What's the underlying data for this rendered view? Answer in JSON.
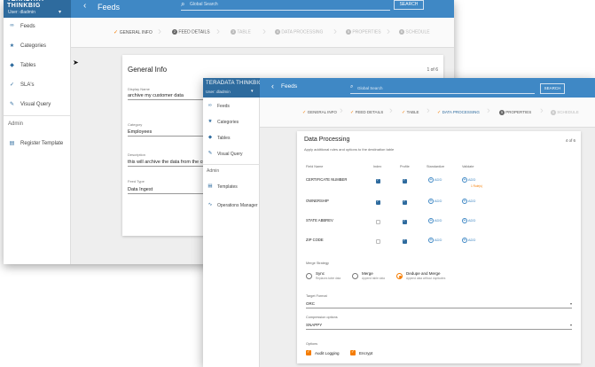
{
  "back": {
    "brand": {
      "logo": "TERADATA THINKBIG",
      "user": "User: dladmin"
    },
    "header": {
      "title": "Feeds",
      "search_placeholder": "Global Search",
      "search_button": "SEARCH"
    },
    "sidebar": {
      "items": [
        {
          "label": "Feeds",
          "icon": "link-icon"
        },
        {
          "label": "Categories",
          "icon": "star-icon"
        },
        {
          "label": "Tables",
          "icon": "database-icon"
        },
        {
          "label": "SLA's",
          "icon": "sla-icon"
        },
        {
          "label": "Visual Query",
          "icon": "pencil-icon"
        }
      ],
      "section_admin": "Admin",
      "admin_items": [
        {
          "label": "Register Template",
          "icon": "template-icon"
        }
      ]
    },
    "steps": [
      {
        "label": "GENERAL INFO",
        "state": "done"
      },
      {
        "num": "2",
        "label": "FEED DETAILS",
        "state": "current"
      },
      {
        "num": "3",
        "label": "TABLE",
        "state": "todo"
      },
      {
        "num": "4",
        "label": "DATA PROCESSING",
        "state": "todo"
      },
      {
        "num": "5",
        "label": "PROPERTIES",
        "state": "todo"
      },
      {
        "num": "6",
        "label": "SCHEDULE",
        "state": "todo"
      }
    ],
    "card": {
      "title": "General Info",
      "page": "1 of 6",
      "fields": [
        {
          "label": "Display Name",
          "value": "archive my customer data"
        },
        {
          "label": "Category",
          "value": "Employees"
        },
        {
          "label": "Description",
          "value": "this will archive the data from the customer"
        },
        {
          "label": "Feed Type",
          "value": "Data Ingest"
        }
      ]
    }
  },
  "front": {
    "brand": {
      "logo": "TERADATA THINKBIG",
      "user": "User: dladmin"
    },
    "header": {
      "title": "Feeds",
      "search_placeholder": "Global Search",
      "search_button": "SEARCH"
    },
    "sidebar": {
      "items": [
        {
          "label": "Feeds",
          "icon": "link-icon"
        },
        {
          "label": "Categories",
          "icon": "star-icon"
        },
        {
          "label": "Tables",
          "icon": "database-icon"
        },
        {
          "label": "Visual Query",
          "icon": "pencil-icon"
        }
      ],
      "section_admin": "Admin",
      "admin_items": [
        {
          "label": "Templates",
          "icon": "template-icon"
        },
        {
          "label": "Operations Manager",
          "icon": "pulse-icon"
        }
      ]
    },
    "steps": [
      {
        "label": "GENERAL INFO",
        "state": "done"
      },
      {
        "label": "FEED DETAILS",
        "state": "done"
      },
      {
        "label": "TABLE",
        "state": "done"
      },
      {
        "label": "DATA PROCESSING",
        "state": "current"
      },
      {
        "num": "5",
        "label": "PROPERTIES",
        "state": "next"
      },
      {
        "num": "6",
        "label": "SCHEDULE",
        "state": "todo"
      }
    ],
    "card": {
      "title": "Data Processing",
      "subtitle": "Apply additional rules and options to the destination table",
      "page": "4 of 6",
      "columns": [
        "Field Name",
        "Index",
        "Profile",
        "Standardize",
        "Validate"
      ],
      "add_label": "ADD",
      "rows": [
        {
          "field": "CERTIFICATE NUMBER",
          "index": true,
          "profile": true,
          "validate_rule": "1 Rule(s)"
        },
        {
          "field": "OWNERSHIP",
          "index": true,
          "profile": true,
          "validate_rule": ""
        },
        {
          "field": "STATE ABBREV",
          "index": false,
          "profile": true,
          "validate_rule": ""
        },
        {
          "field": "ZIP CODE",
          "index": false,
          "profile": true,
          "validate_rule": ""
        }
      ],
      "merge_label": "Merge Strategy",
      "merge_options": [
        {
          "label": "Sync",
          "sub": "Replaces table data",
          "selected": false
        },
        {
          "label": "Merge",
          "sub": "Append table data",
          "selected": false
        },
        {
          "label": "Dedupe and Merge",
          "sub": "Append data without duplicates",
          "selected": true
        }
      ],
      "target_format_label": "Target Format",
      "target_format_value": "ORC",
      "compression_label": "Compression options",
      "compression_value": "SNAPPY",
      "options_label": "Options",
      "options": [
        {
          "label": "Audit Logging",
          "checked": true
        },
        {
          "label": "Encrypt",
          "checked": true
        }
      ]
    }
  },
  "colors": {
    "header": "#3f88c5",
    "brand": "#2e6b9e",
    "accent": "#f57c00"
  }
}
